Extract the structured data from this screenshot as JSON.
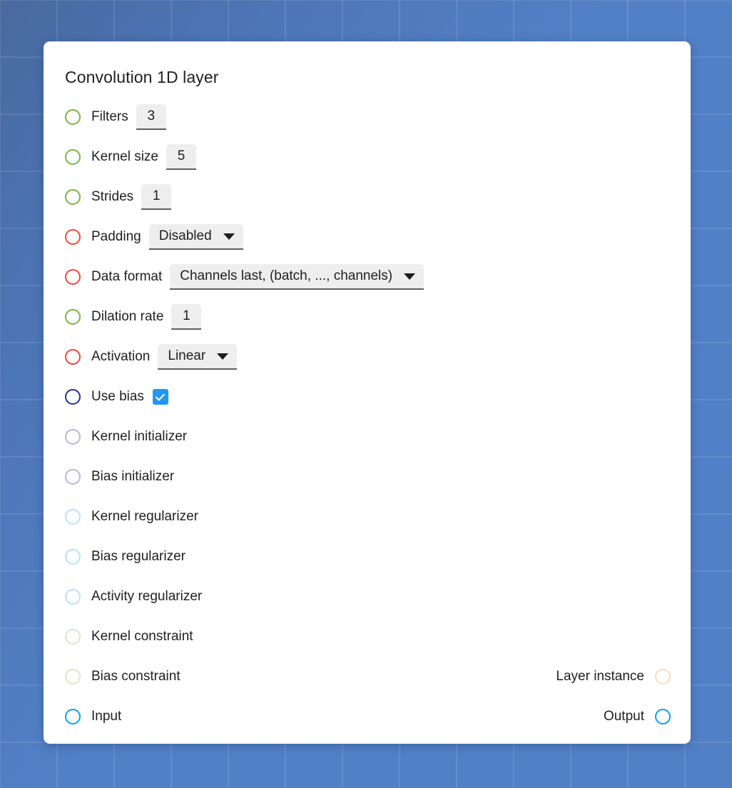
{
  "panel": {
    "title": "Convolution 1D layer"
  },
  "rows": [
    {
      "name": "filters",
      "label": "Filters",
      "port": "green",
      "control": "number",
      "value": "3"
    },
    {
      "name": "kernel-size",
      "label": "Kernel size",
      "port": "green",
      "control": "number",
      "value": "5"
    },
    {
      "name": "strides",
      "label": "Strides",
      "port": "green",
      "control": "number",
      "value": "1"
    },
    {
      "name": "padding",
      "label": "Padding",
      "port": "red",
      "control": "select",
      "value": "Disabled"
    },
    {
      "name": "data-format",
      "label": "Data format",
      "port": "red",
      "control": "select",
      "value": "Channels last, (batch, ..., channels)"
    },
    {
      "name": "dilation-rate",
      "label": "Dilation rate",
      "port": "green",
      "control": "number",
      "value": "1"
    },
    {
      "name": "activation",
      "label": "Activation",
      "port": "red",
      "control": "select",
      "value": "Linear"
    },
    {
      "name": "use-bias",
      "label": "Use bias",
      "port": "navy",
      "control": "checkbox",
      "value": "checked"
    },
    {
      "name": "kernel-initializer",
      "label": "Kernel initializer",
      "port": "lavender",
      "control": "none",
      "value": ""
    },
    {
      "name": "bias-initializer",
      "label": "Bias initializer",
      "port": "lavender",
      "control": "none",
      "value": ""
    },
    {
      "name": "kernel-regularizer",
      "label": "Kernel regularizer",
      "port": "cyan-pale",
      "control": "none",
      "value": ""
    },
    {
      "name": "bias-regularizer",
      "label": "Bias regularizer",
      "port": "cyan-pale",
      "control": "none",
      "value": ""
    },
    {
      "name": "activity-regularizer",
      "label": "Activity regularizer",
      "port": "cyan-pale",
      "control": "none",
      "value": ""
    },
    {
      "name": "kernel-constraint",
      "label": "Kernel constraint",
      "port": "green-pale",
      "control": "none",
      "value": ""
    },
    {
      "name": "bias-constraint",
      "label": "Bias constraint",
      "port": "green-pale",
      "control": "none",
      "value": ""
    },
    {
      "name": "input",
      "label": "Input",
      "port": "blue",
      "control": "none",
      "value": ""
    }
  ],
  "outputs": {
    "layer_instance": {
      "label": "Layer instance",
      "port": "orange-pale"
    },
    "output": {
      "label": "Output",
      "port": "blue"
    }
  },
  "colors": {
    "green": "#76b83f",
    "red": "#f4463a",
    "navy": "#24309a",
    "lavender": "#b9b6d6",
    "cyan_pale": "#b4e3f6",
    "green_pale": "#d9e9c4",
    "blue": "#0aa1ef",
    "orange_pale": "#fcdcb4",
    "checkbox": "#2196f3",
    "field_bg": "#eeeeee",
    "field_underline": "#5f5f5f",
    "card_bg": "#ffffff",
    "canvas_bg": "#5280c6",
    "text": "#212121"
  }
}
